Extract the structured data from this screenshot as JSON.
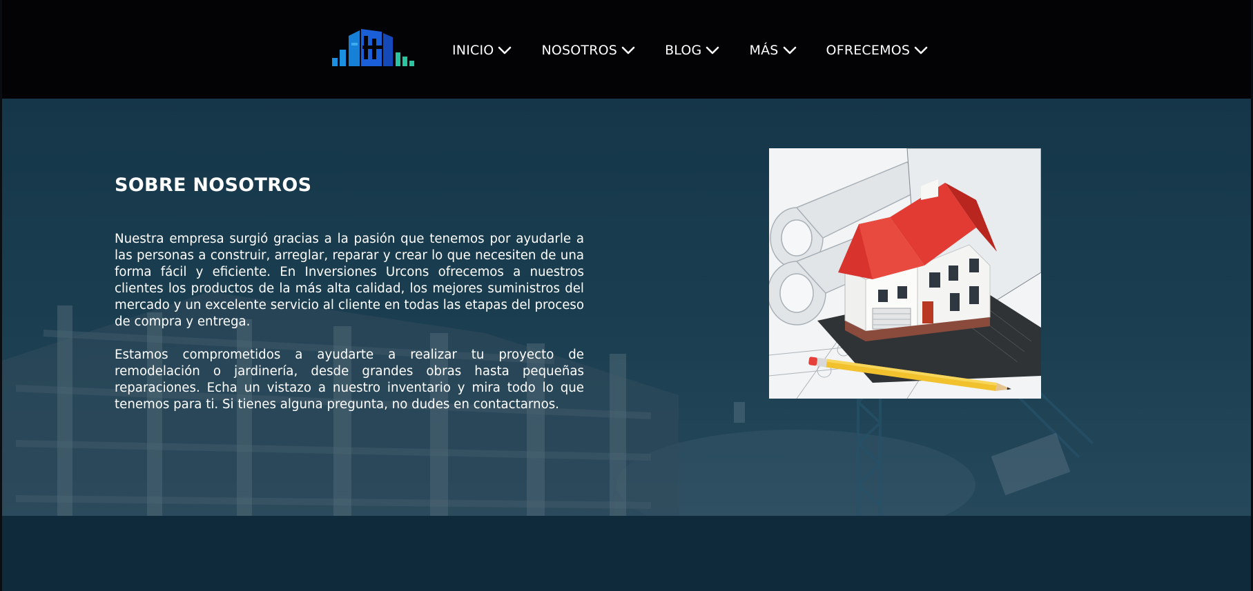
{
  "header": {
    "logo_icon": "building-logo-icon",
    "nav": [
      {
        "label": "INICIO",
        "icon": "chevron-down-icon"
      },
      {
        "label": "NOSOTROS",
        "icon": "chevron-down-icon"
      },
      {
        "label": "BLOG",
        "icon": "chevron-down-icon"
      },
      {
        "label": "MÁS",
        "icon": "chevron-down-icon"
      },
      {
        "label": "OFRECEMOS",
        "icon": "chevron-down-icon"
      }
    ]
  },
  "about": {
    "title": "SOBRE NOSOTROS",
    "paragraphs": [
      "Nuestra empresa surgió gracias a la pasión que tenemos por ayudarle a las personas a construir, arreglar, reparar y crear lo que necesiten de una forma fácil y eficiente. En Inversiones Urcons ofrecemos a nuestros clientes los productos de la más alta calidad, los mejores suministros del mercado y un excelente servicio al cliente en todas las etapas del proceso de compra y entrega.",
      "Estamos comprometidos a ayudarte a realizar tu proyecto de remodelación o jardinería, desde grandes obras hasta pequeñas reparaciones. Echa un vistazo a nuestro inventario y mira todo lo que tenemos para ti. Si tienes alguna pregunta, no dudes en contactarnos."
    ],
    "image_icon": "house-on-blueprints-image",
    "background_icon": "construction-site-background"
  },
  "colors": {
    "header_bg": "#030305",
    "section_bg": "#1d4356",
    "lower_bg": "#0f2a3a",
    "text": "#ffffff",
    "logo_blue": "#1b8fe0",
    "logo_green": "#2bc4a0"
  }
}
